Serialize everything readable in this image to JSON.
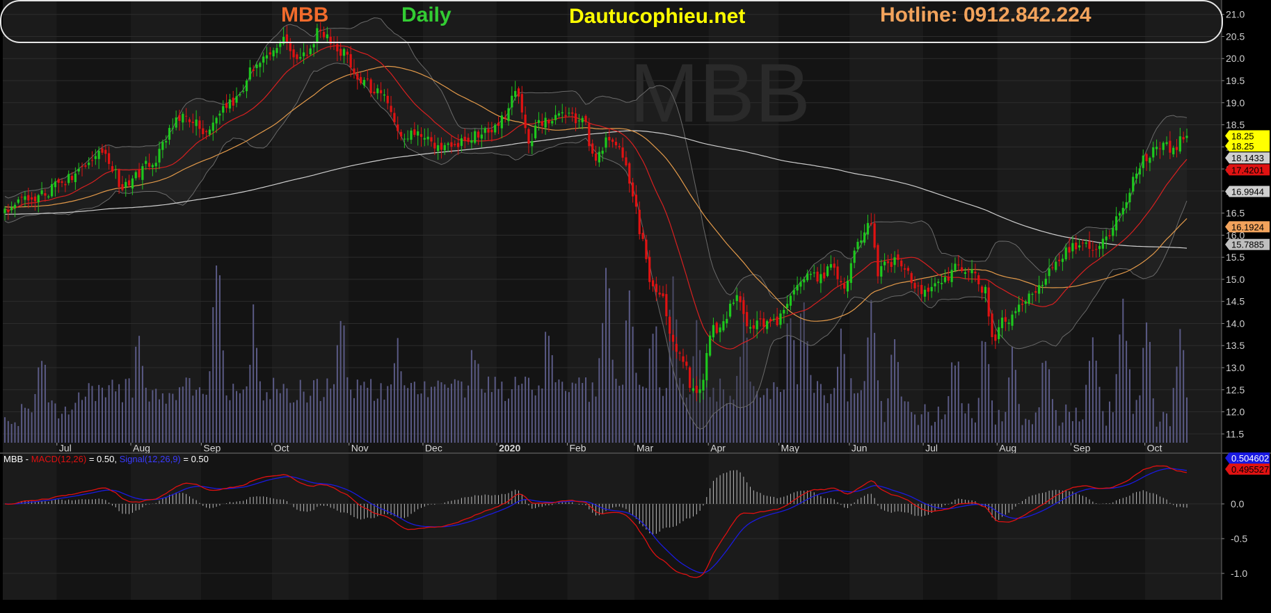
{
  "header": {
    "symbol": "MBB",
    "period": "Daily",
    "site": "Dautucophieu.net",
    "hotline": "Hotline: 0912.842.224",
    "watermark": "MBB"
  },
  "colors": {
    "background": "#000000",
    "panel": "#1b1b1b",
    "panel_alt": "#141414",
    "up_candle": "#1ec81e",
    "down_candle": "#e01212",
    "volume": "#5a5a85",
    "ma_fast": "#d82020",
    "ma_mid": "#e39a4a",
    "ma_slow": "#cfcfcf",
    "bollinger": "#6a6a6a",
    "macd_line": "#e01010",
    "signal_line": "#1a1ae0",
    "hdr_symbol": "#f26b2c",
    "hdr_period": "#33cc33",
    "hdr_site": "#ffff00",
    "hdr_hotline": "#f2a35c"
  },
  "chart_data": [
    {
      "type": "candlestick",
      "symbol": "MBB",
      "period": "Daily",
      "ylim": [
        11.3,
        21.2
      ],
      "yticks": [
        11.5,
        12.0,
        12.5,
        13.0,
        13.5,
        14.0,
        14.5,
        15.0,
        15.5,
        16.0,
        16.5,
        17.0,
        17.5,
        18.0,
        18.5,
        19.0,
        19.5,
        20.0,
        20.5,
        21.0
      ],
      "ytick_labels": [
        "11.5",
        "12.0",
        "12.5",
        "13.0",
        "13.5",
        "14.0",
        "14.5",
        "15.0",
        "15.5",
        "16.0",
        "16.5",
        "17.0",
        "17.5",
        "18.0",
        "18.5",
        "19.0",
        "19.5",
        "20.0",
        "20.5",
        "21.0"
      ],
      "months": [
        {
          "label": "Jul",
          "bold": false
        },
        {
          "label": "Aug",
          "bold": false
        },
        {
          "label": "Sep",
          "bold": false
        },
        {
          "label": "Oct",
          "bold": false
        },
        {
          "label": "Nov",
          "bold": false
        },
        {
          "label": "Dec",
          "bold": false
        },
        {
          "label": "2020",
          "bold": true
        },
        {
          "label": "Feb",
          "bold": false
        },
        {
          "label": "Mar",
          "bold": false
        },
        {
          "label": "Apr",
          "bold": false
        },
        {
          "label": "May",
          "bold": false
        },
        {
          "label": "Jun",
          "bold": false
        },
        {
          "label": "Jul",
          "bold": false
        },
        {
          "label": "Aug",
          "bold": false
        },
        {
          "label": "Sep",
          "bold": false
        },
        {
          "label": "Oct",
          "bold": false
        }
      ],
      "close_anchors": [
        [
          0,
          16.6
        ],
        [
          10,
          16.9
        ],
        [
          20,
          17.3
        ],
        [
          28,
          17.9
        ],
        [
          36,
          17.1
        ],
        [
          44,
          17.7
        ],
        [
          52,
          18.7
        ],
        [
          60,
          18.4
        ],
        [
          68,
          19.0
        ],
        [
          76,
          20.0
        ],
        [
          82,
          20.4
        ],
        [
          88,
          20.0
        ],
        [
          94,
          20.6
        ],
        [
          100,
          20.2
        ],
        [
          106,
          19.5
        ],
        [
          112,
          19.2
        ],
        [
          118,
          18.3
        ],
        [
          124,
          18.3
        ],
        [
          130,
          18.0
        ],
        [
          136,
          18.1
        ],
        [
          142,
          18.3
        ],
        [
          148,
          18.6
        ],
        [
          152,
          19.4
        ],
        [
          156,
          18.2
        ],
        [
          160,
          18.6
        ],
        [
          166,
          18.8
        ],
        [
          172,
          18.6
        ],
        [
          176,
          17.7
        ],
        [
          180,
          18.2
        ],
        [
          184,
          17.8
        ],
        [
          187,
          16.8
        ],
        [
          190,
          15.8
        ],
        [
          193,
          14.8
        ],
        [
          196,
          14.5
        ],
        [
          199,
          13.5
        ],
        [
          202,
          13.2
        ],
        [
          205,
          12.5
        ],
        [
          207,
          12.4
        ],
        [
          210,
          13.8
        ],
        [
          214,
          14.0
        ],
        [
          218,
          14.7
        ],
        [
          222,
          13.9
        ],
        [
          226,
          14.0
        ],
        [
          230,
          14.1
        ],
        [
          234,
          14.6
        ],
        [
          238,
          15.1
        ],
        [
          242,
          15.0
        ],
        [
          246,
          15.3
        ],
        [
          250,
          14.9
        ],
        [
          254,
          15.8
        ],
        [
          258,
          16.2
        ],
        [
          260,
          15.2
        ],
        [
          264,
          15.4
        ],
        [
          268,
          15.3
        ],
        [
          272,
          14.8
        ],
        [
          276,
          14.8
        ],
        [
          280,
          15.0
        ],
        [
          284,
          15.3
        ],
        [
          288,
          15.1
        ],
        [
          292,
          14.7
        ],
        [
          294,
          13.6
        ],
        [
          297,
          14.0
        ],
        [
          300,
          14.1
        ],
        [
          304,
          14.5
        ],
        [
          308,
          14.8
        ],
        [
          312,
          15.2
        ],
        [
          316,
          15.6
        ],
        [
          320,
          15.8
        ],
        [
          324,
          15.7
        ],
        [
          328,
          15.9
        ],
        [
          332,
          16.5
        ],
        [
          336,
          17.2
        ],
        [
          340,
          17.8
        ],
        [
          344,
          18.0
        ],
        [
          348,
          18.0
        ],
        [
          352,
          18.25
        ]
      ],
      "volume_scale": "relative",
      "price_tags": [
        {
          "label": "18.25",
          "value": 18.25,
          "bg": "#ffff00",
          "fg": "#000000"
        },
        {
          "label": "18.25",
          "value": 18.02,
          "bg": "#ffff00",
          "fg": "#000000"
        },
        {
          "label": "18.1433",
          "value": 17.75,
          "bg": "#cfcfcf",
          "fg": "#000000"
        },
        {
          "label": "17.4201",
          "value": 17.48,
          "bg": "#e01212",
          "fg": "#000000"
        },
        {
          "label": "16.9944",
          "value": 16.99,
          "bg": "#cfcfcf",
          "fg": "#000000"
        },
        {
          "label": "16.1924",
          "value": 16.19,
          "bg": "#f2a35c",
          "fg": "#000000"
        },
        {
          "label": "15.7885",
          "value": 15.79,
          "bg": "#bfbfbf",
          "fg": "#000000"
        }
      ],
      "ma_windows": {
        "fast": 20,
        "mid": 50,
        "slow": 200
      }
    },
    {
      "type": "line",
      "indicator": "MACD",
      "legend": {
        "symbol": "MBB",
        "dash": " - ",
        "macd_label": "MACD(12,26)",
        "macd_value": " = 0.50, ",
        "signal_label": "Signal(12,26,9)",
        "signal_value": " = 0.50"
      },
      "ylim": [
        -1.38,
        0.72
      ],
      "yticks": [
        0.0,
        -0.5,
        -1.0
      ],
      "ytick_labels": [
        "0.0",
        "-0.5",
        "-1.0"
      ],
      "value_tags": [
        {
          "label": "0.504602",
          "value": 0.5046,
          "bg": "#1a1ae0",
          "fg": "#ffffff"
        },
        {
          "label": "0.495527",
          "value": 0.4955,
          "bg": "#e01212",
          "fg": "#000000"
        }
      ],
      "series": [
        {
          "name": "MACD(12,26)",
          "color": "#e01010"
        },
        {
          "name": "Signal(12,26,9)",
          "color": "#1a1ae0"
        }
      ]
    }
  ]
}
